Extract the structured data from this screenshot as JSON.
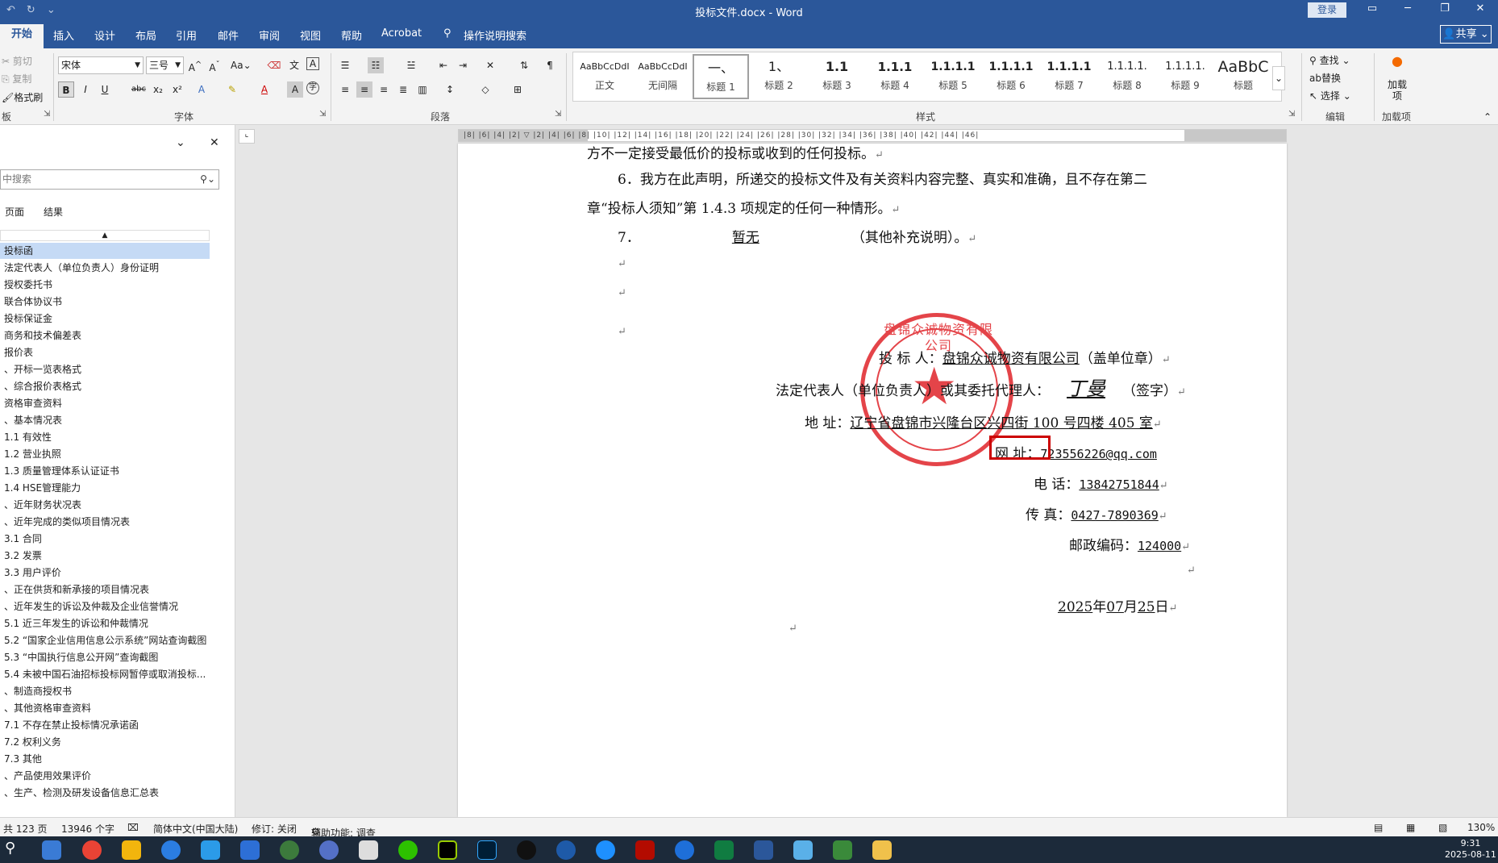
{
  "window": {
    "title": "投标文件.docx - Word",
    "login": "登录",
    "share": "共享"
  },
  "tabs": [
    "开始",
    "插入",
    "设计",
    "布局",
    "引用",
    "邮件",
    "审阅",
    "视图",
    "帮助",
    "Acrobat",
    "操作说明搜索"
  ],
  "ribbon": {
    "clipboard": {
      "cut": "剪切",
      "copy": "复制",
      "format_painter": "格式刷",
      "label": "板"
    },
    "font": {
      "name": "宋体",
      "size": "三号",
      "label": "字体"
    },
    "paragraph": {
      "label": "段落"
    },
    "styles": {
      "label": "样式",
      "items": [
        {
          "preview": "AaBbCcDdI",
          "name": "正文"
        },
        {
          "preview": "AaBbCcDdI",
          "name": "无间隔"
        },
        {
          "preview": "一、",
          "name": "标题 1"
        },
        {
          "preview": "1、",
          "name": "标题 2"
        },
        {
          "preview": "1.1",
          "name": "标题 3"
        },
        {
          "preview": "1.1.1",
          "name": "标题 4"
        },
        {
          "preview": "1.1.1.1",
          "name": "标题 5"
        },
        {
          "preview": "1.1.1.1",
          "name": "标题 6"
        },
        {
          "preview": "1.1.1.1",
          "name": "标题 7"
        },
        {
          "preview": "1.1.1.1.",
          "name": "标题 8"
        },
        {
          "preview": "1.1.1.1.",
          "name": "标题 9"
        },
        {
          "preview": "AaBbC",
          "name": "标题"
        }
      ]
    },
    "editing": {
      "find": "查找",
      "replace": "替换",
      "select": "选择",
      "label": "编辑"
    },
    "addins": {
      "name": "加载项",
      "label": "加载项"
    }
  },
  "nav": {
    "search_placeholder": "中搜索",
    "tabs": [
      "页面",
      "结果"
    ],
    "items": [
      "投标函",
      "法定代表人（单位负责人）身份证明",
      "授权委托书",
      "联合体协议书",
      "投标保证金",
      "商务和技术偏差表",
      "报价表",
      "、开标一览表格式",
      "、综合报价表格式",
      "资格审查资料",
      "、基本情况表",
      "1.1 有效性",
      "1.2 营业执照",
      "1.3 质量管理体系认证证书",
      "1.4 HSE管理能力",
      "、近年财务状况表",
      "、近年完成的类似项目情况表",
      "3.1 合同",
      "3.2 发票",
      "3.3 用户评价",
      "、正在供货和新承接的项目情况表",
      "、近年发生的诉讼及仲裁及企业信誉情况",
      "5.1 近三年发生的诉讼和仲裁情况",
      "5.2 “国家企业信用信息公示系统”网站查询截图",
      "5.3 “中国执行信息公开网”查询截图",
      "5.4 未被中国石油招标投标网暂停或取消投标...",
      "、制造商授权书",
      "、其他资格审查资料",
      "7.1 不存在禁止投标情况承诺函",
      "7.2 权利义务",
      "7.3 其他",
      "、产品使用效果评价",
      "、生产、检测及研发设备信息汇总表"
    ]
  },
  "doc": {
    "line1": "方不一定接受最低价的投标或收到的任何投标。",
    "line2": "6．我方在此声明，所递交的投标文件及有关资料内容完整、真实和准确，且不存在第二",
    "line3": "章“投标人须知”第 1.4.3 项规定的任何一种情形。",
    "line4_pre": "7．",
    "line4_val": "暂无",
    "line4_post": "（其他补充说明）。",
    "bidder_label": "投 标 人：",
    "bidder_value": "盘锦众诚物资有限公司",
    "bidder_note": "（盖单位章）",
    "rep_label": "法定代表人（单位负责人）或其委托代理人：",
    "rep_note": "（签字）",
    "addr_label": "地      址：",
    "addr_value": "辽宁省盘锦市兴隆台区兴四街 100 号四楼 405 室",
    "web_label": "网      址：",
    "web_value": "723556226@qq.com",
    "tel_label": "电      话：",
    "tel_value": "13842751844",
    "fax_label": "传      真：",
    "fax_value": "0427-7890369",
    "zip_label": "邮政编码：",
    "zip_value": "124000",
    "date_y": "2025",
    "date_m": "07",
    "date_d": "25",
    "y": "年",
    "m": "月",
    "d": "日",
    "para": "↵",
    "signature": "丁曼",
    "stamp_text": "盘锦众诚物资有限公司"
  },
  "status": {
    "pages": "共 123 页",
    "words": "13946 个字",
    "lang": "简体中文(中国大陆)",
    "track": "修订: 关闭",
    "access": "辅助功能: 调查",
    "zoom": "130%"
  },
  "clock": {
    "time": "9:31",
    "date": "2025-08-11"
  }
}
